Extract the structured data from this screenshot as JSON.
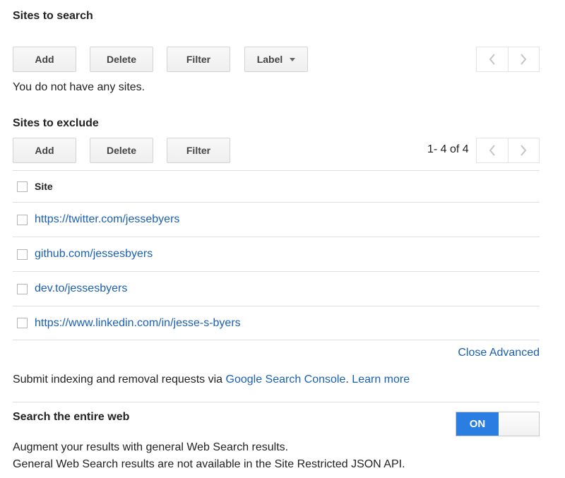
{
  "sites_to_search": {
    "title": "Sites to search",
    "buttons": {
      "add": "Add",
      "delete": "Delete",
      "filter": "Filter",
      "label": "Label"
    },
    "empty_message": "You do not have any sites."
  },
  "sites_to_exclude": {
    "title": "Sites to exclude",
    "buttons": {
      "add": "Add",
      "delete": "Delete",
      "filter": "Filter"
    },
    "pagination": "1- 4 of 4",
    "column_header": "Site",
    "rows": [
      "https://twitter.com/jessebyers",
      "github.com/jessesbyers",
      "dev.to/jessesbyers",
      "https://www.linkedin.com/in/jesse-s-byers"
    ]
  },
  "close_advanced": "Close Advanced",
  "indexing": {
    "prefix": "Submit indexing and removal requests via ",
    "console_link": "Google Search Console",
    "separator": ".",
    "learn_more": "Learn more"
  },
  "entire_web": {
    "title": "Search the entire web",
    "toggle_label": "ON",
    "line1": "Augment your results with general Web Search results.",
    "line2": "General Web Search results are not available in the Site Restricted JSON API."
  },
  "colors": {
    "link": "#1a5fb4",
    "toggle_on": "#2a7de1"
  }
}
